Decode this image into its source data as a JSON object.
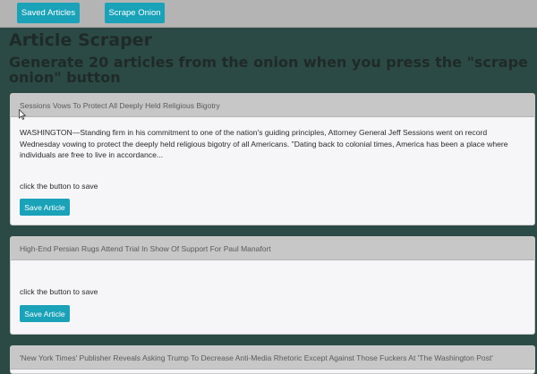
{
  "navbar": {
    "saved_label": "Saved Articles",
    "scrape_label": "Scrape Onion"
  },
  "page": {
    "title": "Article Scraper",
    "subtitle": "Generate 20 articles from the onion when you press the \"scrape onion\" button"
  },
  "articles": [
    {
      "headline": "Sessions Vows To Protect All Deeply Held Religious Bigotry",
      "summary": "WASHINGTON—Standing firm in his commitment to one of the nation's guiding principles, Attorney General Jeff Sessions went on record Wednesday vowing to protect the deeply held religious bigotry of all Americans. \"Dating back to colonial times, America has been a place where individuals are free to live in accordance...",
      "hint": "click the button to save",
      "button": "Save Article"
    },
    {
      "headline": "High-End Persian Rugs Attend Trial In Show Of Support For Paul Manafort",
      "summary": "",
      "hint": "click the button to save",
      "button": "Save Article"
    },
    {
      "headline": "'New York Times' Publisher Reveals Asking Trump To Decrease Anti-Media Rhetoric Except Against Those Fuckers At 'The Washington Post'",
      "summary": "",
      "hint": "",
      "button": ""
    }
  ]
}
